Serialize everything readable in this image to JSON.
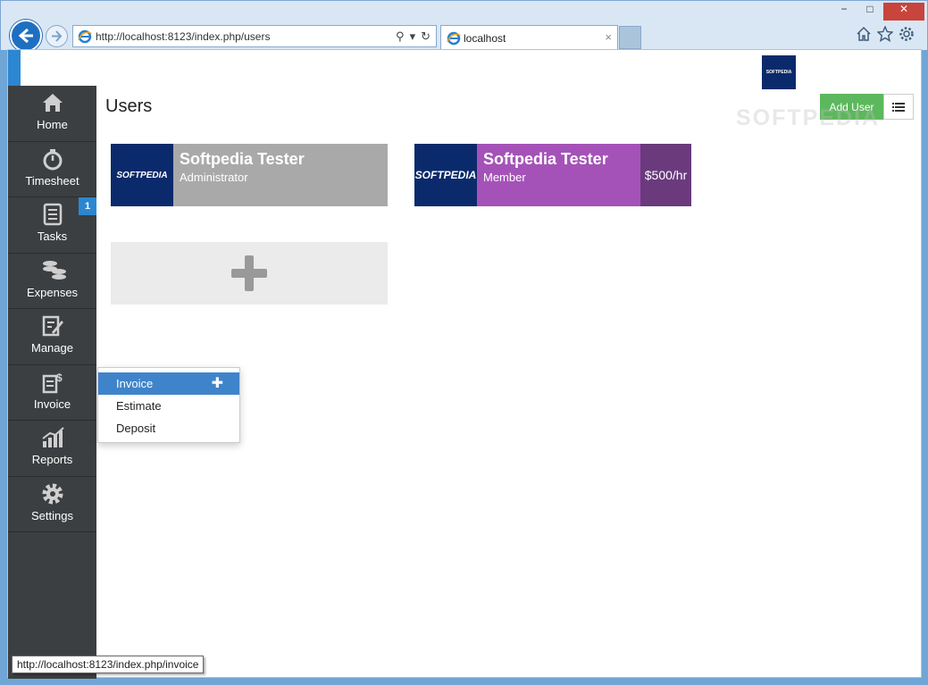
{
  "browser": {
    "address_url": "http://localhost:8123/index.php/users",
    "tab_title": "localhost",
    "tab_close": "×",
    "window_min": "−",
    "window_max": "□",
    "window_close": "✕"
  },
  "app": {
    "brand_logo_text": "SOFTPEDIA",
    "page_title": "Users",
    "add_user_label": "Add User",
    "watermark": "SOFTPEDIA"
  },
  "sidebar": {
    "items": [
      {
        "label": "Home",
        "icon": "home-icon"
      },
      {
        "label": "Timesheet",
        "icon": "stopwatch-icon"
      },
      {
        "label": "Tasks",
        "icon": "tasks-icon",
        "badge": "1"
      },
      {
        "label": "Expenses",
        "icon": "coins-icon"
      },
      {
        "label": "Manage",
        "icon": "edit-icon"
      },
      {
        "label": "Invoice",
        "icon": "invoice-icon"
      },
      {
        "label": "Reports",
        "icon": "bar-chart-icon"
      },
      {
        "label": "Settings",
        "icon": "gear-icon"
      }
    ]
  },
  "users": [
    {
      "name": "Softpedia Tester",
      "role": "Administrator",
      "logo": "SOFTPEDIA",
      "color": "#a9a9a9"
    },
    {
      "name": "Softpedia Tester",
      "role": "Member",
      "logo": "SOFTPEDIA",
      "rate": "$500/hr",
      "color": "#a552b8"
    }
  ],
  "invoice_menu": {
    "items": [
      "Invoice",
      "Estimate",
      "Deposit"
    ],
    "plus": "✚"
  },
  "status_bar": {
    "link_url": "http://localhost:8123/index.php/invoice"
  },
  "colors": {
    "accent": "#2b87d1",
    "sidebar": "#3c3f41",
    "add_user": "#5cb85c",
    "menu_active": "#3f84cb"
  }
}
